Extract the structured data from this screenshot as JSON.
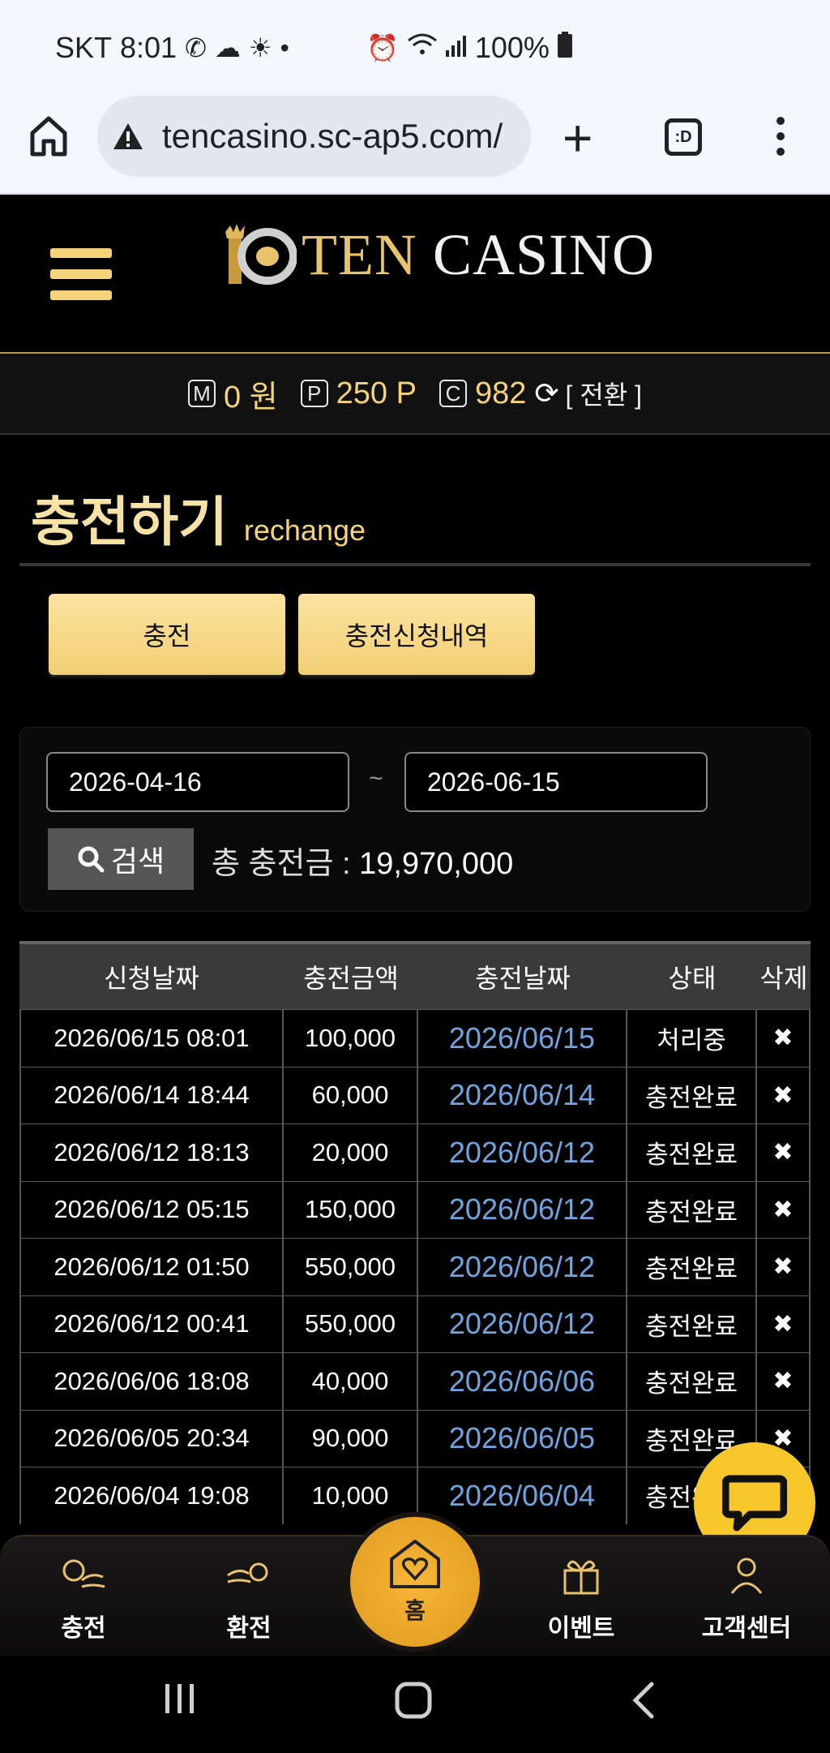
{
  "status_bar": {
    "carrier": "SKT",
    "time": "8:01",
    "battery": "100%"
  },
  "browser": {
    "url": "tencasino.sc-ap5.com/",
    "tabs_label": ":D"
  },
  "header": {
    "logo_ten": "TEN",
    "logo_casino": "CASINO"
  },
  "balance": {
    "money_badge": "M",
    "money_value": "0 원",
    "point_badge": "P",
    "point_value": "250 P",
    "coin_badge": "C",
    "coin_value": "982",
    "convert_label": "[ 전환 ]"
  },
  "title": {
    "korean": "충전하기",
    "english": "rechange"
  },
  "buttons": {
    "charge": "충전",
    "history": "충전신청내역"
  },
  "search": {
    "date_from": "2026-04-16",
    "separator": "~",
    "date_to": "2026-06-15",
    "search_label": "검색",
    "total_label": "총 충전금 :",
    "total_value": "19,970,000"
  },
  "table": {
    "headers": [
      "신청날짜",
      "충전금액",
      "충전날짜",
      "상태",
      "삭제"
    ],
    "delete_symbol": "✖",
    "rows": [
      [
        "2026/06/15 08:01",
        "100,000",
        "2026/06/15",
        "처리중"
      ],
      [
        "2026/06/14 18:44",
        "60,000",
        "2026/06/14",
        "충전완료"
      ],
      [
        "2026/06/12 18:13",
        "20,000",
        "2026/06/12",
        "충전완료"
      ],
      [
        "2026/06/12 05:15",
        "150,000",
        "2026/06/12",
        "충전완료"
      ],
      [
        "2026/06/12 01:50",
        "550,000",
        "2026/06/12",
        "충전완료"
      ],
      [
        "2026/06/12 00:41",
        "550,000",
        "2026/06/12",
        "충전완료"
      ],
      [
        "2026/06/06 18:08",
        "40,000",
        "2026/06/06",
        "충전완료"
      ],
      [
        "2026/06/05 20:34",
        "90,000",
        "2026/06/05",
        "충전완료"
      ],
      [
        "2026/06/04 19:08",
        "10,000",
        "2026/06/04",
        "충전완료"
      ]
    ]
  },
  "bottom_nav": {
    "charge": "충전",
    "exchange": "환전",
    "home": "홈",
    "event": "이벤트",
    "support": "고객센터"
  },
  "colors": {
    "gold": "#f5d37a",
    "link_blue": "#6fa4e0",
    "home_orange": "#f0a82a",
    "chat_yellow": "#f7c72c"
  }
}
